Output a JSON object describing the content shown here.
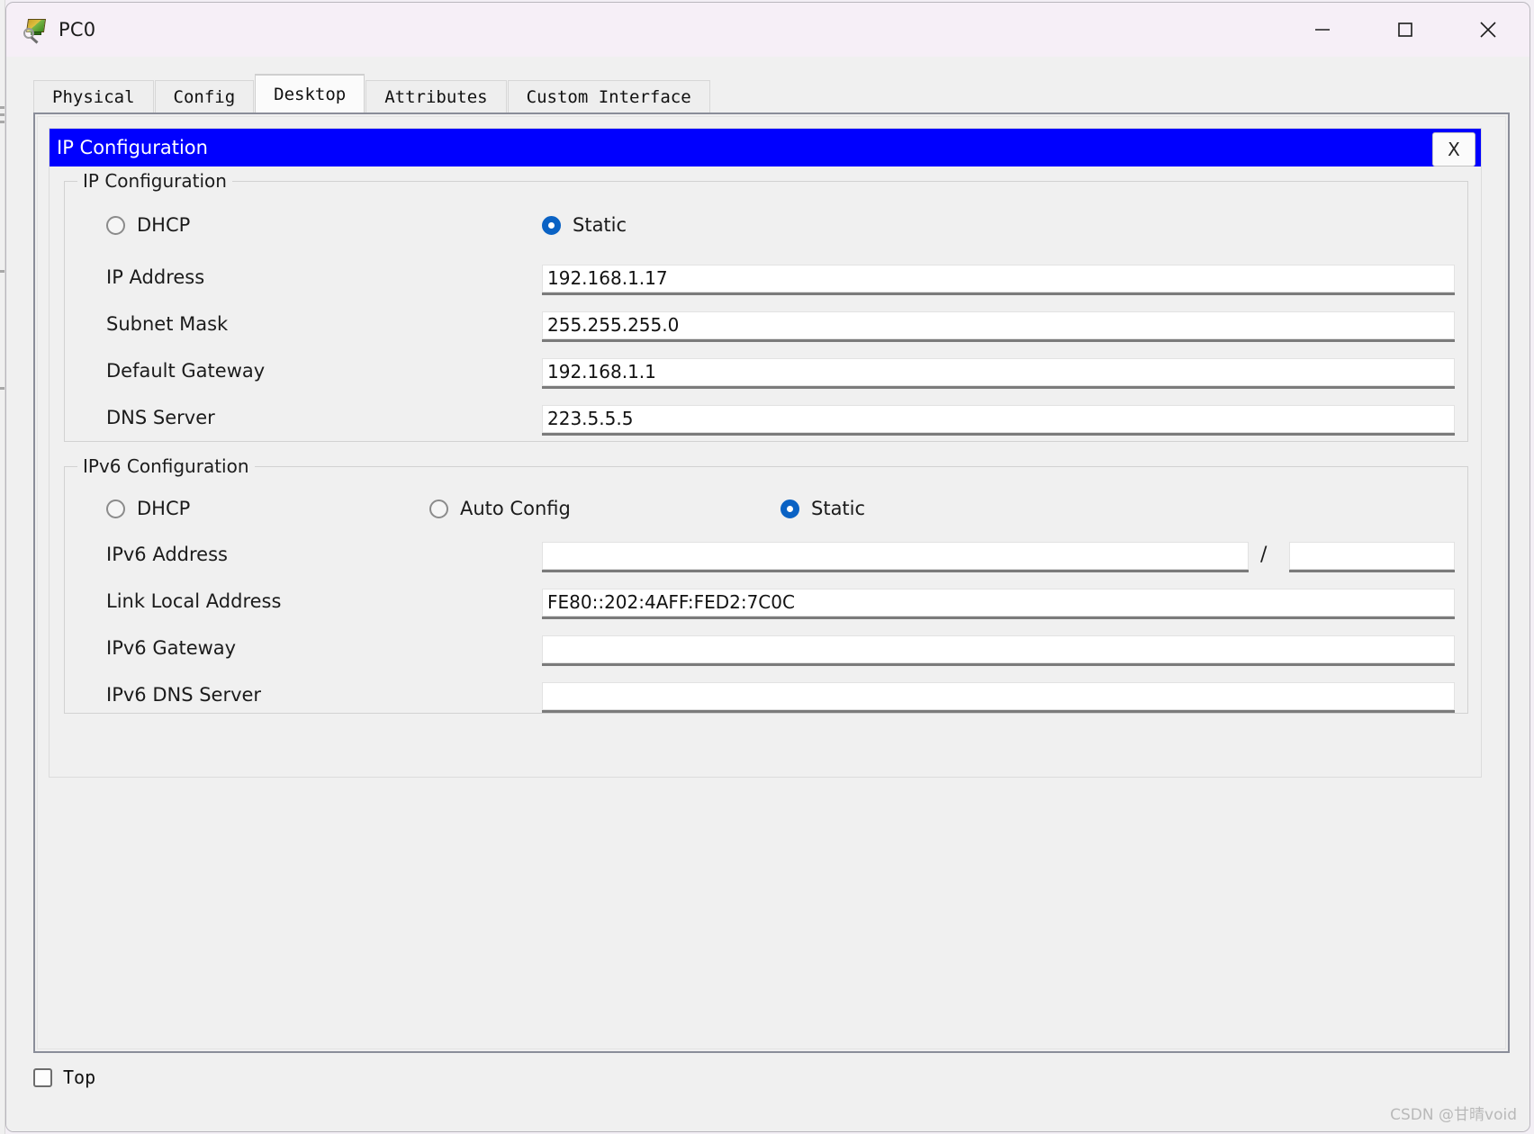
{
  "window": {
    "title": "PC0",
    "icon": "pc-device-icon",
    "controls": {
      "minimize": "minimize-icon",
      "maximize": "maximize-icon",
      "close": "close-icon"
    }
  },
  "tabs": [
    {
      "label": "Physical",
      "active": false
    },
    {
      "label": "Config",
      "active": false
    },
    {
      "label": "Desktop",
      "active": true
    },
    {
      "label": "Attributes",
      "active": false
    },
    {
      "label": "Custom Interface",
      "active": false
    }
  ],
  "ip_config_window": {
    "title": "IP Configuration",
    "close_label": "X",
    "titlebar_color": "#0000ff",
    "ipv4": {
      "legend": "IP Configuration",
      "modes": [
        {
          "label": "DHCP",
          "selected": false
        },
        {
          "label": "Static",
          "selected": true
        }
      ],
      "fields": [
        {
          "label": "IP Address",
          "value": "192.168.1.17"
        },
        {
          "label": "Subnet Mask",
          "value": "255.255.255.0"
        },
        {
          "label": "Default Gateway",
          "value": "192.168.1.1"
        },
        {
          "label": "DNS Server",
          "value": "223.5.5.5"
        }
      ]
    },
    "ipv6": {
      "legend": "IPv6 Configuration",
      "modes": [
        {
          "label": "DHCP",
          "selected": false
        },
        {
          "label": "Auto Config",
          "selected": false
        },
        {
          "label": "Static",
          "selected": true
        }
      ],
      "prefix_separator": "/",
      "fields": [
        {
          "label": "IPv6 Address",
          "value": "",
          "prefix_value": ""
        },
        {
          "label": "Link Local Address",
          "value": "FE80::202:4AFF:FED2:7C0C"
        },
        {
          "label": "IPv6 Gateway",
          "value": ""
        },
        {
          "label": "IPv6 DNS Server",
          "value": ""
        }
      ]
    }
  },
  "bottom": {
    "top_checkbox_label": "Top",
    "top_checked": false
  },
  "watermark": "CSDN @甘晴void",
  "colors": {
    "accent_radio": "#0a62c4",
    "title_blue": "#0000ff",
    "window_bg": "#f0f0f0",
    "titlebar_bg": "#f6eff7"
  }
}
